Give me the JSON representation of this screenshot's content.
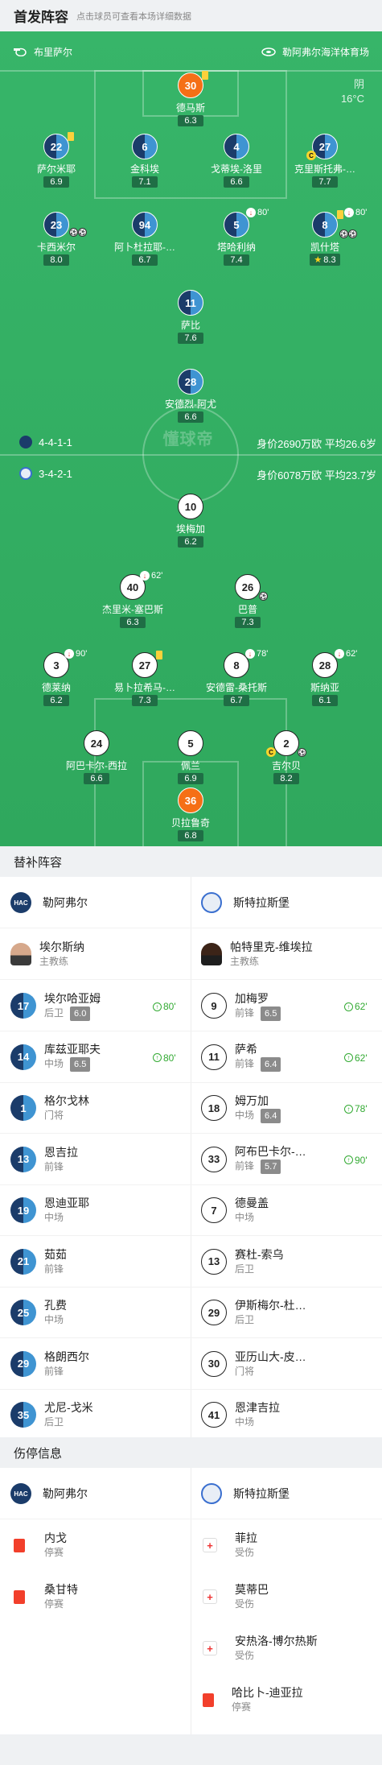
{
  "header": {
    "title": "首发阵容",
    "subtitle": "点击球员可查看本场详细数据"
  },
  "match": {
    "home_team": "布里萨尔",
    "venue": "勒阿弗尔海洋体育场",
    "weather": "阴",
    "temperature": "16°C"
  },
  "home_lineup": [
    {
      "num": "30",
      "name": "德马斯",
      "rating": "6.3",
      "gk": true
    },
    {
      "num": "22",
      "name": "萨尔米耶",
      "rating": "6.9"
    },
    {
      "num": "6",
      "name": "金科埃",
      "rating": "7.1"
    },
    {
      "num": "4",
      "name": "戈蒂埃-洛里",
      "rating": "6.6"
    },
    {
      "num": "27",
      "name": "克里斯托弗-…",
      "rating": "7.7"
    },
    {
      "num": "23",
      "name": "卡西米尔",
      "rating": "8.0"
    },
    {
      "num": "94",
      "name": "阿卜杜拉耶-…",
      "rating": "6.7"
    },
    {
      "num": "5",
      "name": "塔哈利纳",
      "rating": "7.4"
    },
    {
      "num": "8",
      "name": "凯什塔",
      "rating": "8.3"
    },
    {
      "num": "11",
      "name": "萨比",
      "rating": "7.6"
    },
    {
      "num": "28",
      "name": "安德烈-阿尤",
      "rating": "6.6"
    }
  ],
  "away_lineup": [
    {
      "num": "10",
      "name": "埃梅加",
      "rating": "6.2"
    },
    {
      "num": "40",
      "name": "杰里米-塞巴斯",
      "rating": "6.3"
    },
    {
      "num": "26",
      "name": "巴普",
      "rating": "7.3"
    },
    {
      "num": "3",
      "name": "德莱纳",
      "rating": "6.2"
    },
    {
      "num": "27",
      "name": "易卜拉希马-…",
      "rating": "7.3"
    },
    {
      "num": "8",
      "name": "安德雷-桑托斯",
      "rating": "6.7"
    },
    {
      "num": "28",
      "name": "斯纳亚",
      "rating": "6.1"
    },
    {
      "num": "24",
      "name": "阿巴卡尔-西拉",
      "rating": "6.6"
    },
    {
      "num": "5",
      "name": "佩兰",
      "rating": "6.9"
    },
    {
      "num": "2",
      "name": "吉尔贝",
      "rating": "8.2"
    },
    {
      "num": "36",
      "name": "贝拉鲁奇",
      "rating": "6.8",
      "gk": true
    }
  ],
  "sub_times": {
    "h5": "80'",
    "h8": "80'",
    "a40": "62'",
    "a3": "90'",
    "a8": "78'",
    "a28": "62'"
  },
  "formation": {
    "home": "4-4-1-1",
    "home_value": "身价2690万欧  平均26.6岁",
    "away": "3-4-2-1",
    "away_value": "身价6078万欧  平均23.7岁"
  },
  "watermark": "懂球帝",
  "subs": {
    "title": "替补阵容",
    "home_team": "勒阿弗尔",
    "away_team": "斯特拉斯堡",
    "home_coach": {
      "name": "埃尔斯纳",
      "role": "主教练"
    },
    "away_coach": {
      "name": "帕特里克-维埃拉",
      "role": "主教练"
    },
    "home": [
      {
        "num": "17",
        "name": "埃尔哈亚姆",
        "pos": "后卫",
        "rating": "6.0",
        "time": "80'"
      },
      {
        "num": "14",
        "name": "库兹亚耶夫",
        "pos": "中场",
        "rating": "6.5",
        "time": "80'"
      },
      {
        "num": "1",
        "name": "格尔戈林",
        "pos": "门将"
      },
      {
        "num": "13",
        "name": "恩吉拉",
        "pos": "前锋"
      },
      {
        "num": "19",
        "name": "恩迪亚耶",
        "pos": "中场"
      },
      {
        "num": "21",
        "name": "茹茹",
        "pos": "前锋"
      },
      {
        "num": "25",
        "name": "孔费",
        "pos": "中场"
      },
      {
        "num": "29",
        "name": "格朗西尔",
        "pos": "前锋"
      },
      {
        "num": "35",
        "name": "尤尼-戈米",
        "pos": "后卫"
      }
    ],
    "away": [
      {
        "num": "9",
        "name": "加梅罗",
        "pos": "前锋",
        "rating": "6.5",
        "time": "62'"
      },
      {
        "num": "11",
        "name": "萨希",
        "pos": "前锋",
        "rating": "6.4",
        "time": "62'"
      },
      {
        "num": "18",
        "name": "姆万加",
        "pos": "中场",
        "rating": "6.4",
        "time": "78'"
      },
      {
        "num": "33",
        "name": "阿布巴卡尔-…",
        "pos": "前锋",
        "rating": "5.7",
        "time": "90'"
      },
      {
        "num": "7",
        "name": "德曼盖",
        "pos": "中场"
      },
      {
        "num": "13",
        "name": "赛杜-索乌",
        "pos": "后卫"
      },
      {
        "num": "29",
        "name": "伊斯梅尔-杜…",
        "pos": "后卫"
      },
      {
        "num": "30",
        "name": "亚历山大-皮…",
        "pos": "门将"
      },
      {
        "num": "41",
        "name": "恩津吉拉",
        "pos": "中场"
      }
    ]
  },
  "injuries": {
    "title": "伤停信息",
    "home_team": "勒阿弗尔",
    "away_team": "斯特拉斯堡",
    "home": [
      {
        "name": "内戈",
        "status": "停赛"
      },
      {
        "name": "桑甘特",
        "status": "停赛"
      }
    ],
    "away": [
      {
        "name": "菲拉",
        "status": "受伤"
      },
      {
        "name": "莫蒂巴",
        "status": "受伤"
      },
      {
        "name": "安热洛-博尔热斯",
        "status": "受伤"
      },
      {
        "name": "哈比卜-迪亚拉",
        "status": "停赛"
      }
    ]
  }
}
